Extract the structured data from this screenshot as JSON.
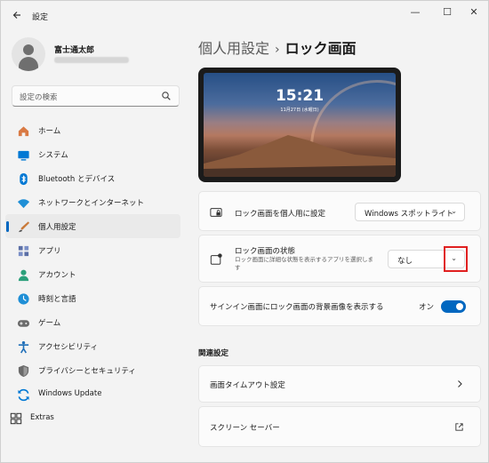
{
  "window": {
    "title": "設定",
    "back_icon": "back-arrow-icon",
    "controls": {
      "minimize": "—",
      "maximize": "☐",
      "close": "✕"
    }
  },
  "profile": {
    "name": "富士通太郎",
    "email": ""
  },
  "search": {
    "placeholder": "設定の検索",
    "icon": "search-icon"
  },
  "sidebar": {
    "items": [
      {
        "label": "ホーム",
        "icon": "home-icon",
        "color": "#d97a44"
      },
      {
        "label": "システム",
        "icon": "system-icon",
        "color": "#0078d4"
      },
      {
        "label": "Bluetooth とデバイス",
        "icon": "bluetooth-icon",
        "color": "#0078d4"
      },
      {
        "label": "ネットワークとインターネット",
        "icon": "network-icon",
        "color": "#1f8fd6"
      },
      {
        "label": "個人用設定",
        "icon": "personalization-icon",
        "color": "#c97a3a",
        "active": true
      },
      {
        "label": "アプリ",
        "icon": "apps-icon",
        "color": "#5b6fa6"
      },
      {
        "label": "アカウント",
        "icon": "account-icon",
        "color": "#2ba07a"
      },
      {
        "label": "時刻と言語",
        "icon": "time-language-icon",
        "color": "#1f8fd6"
      },
      {
        "label": "ゲーム",
        "icon": "gaming-icon",
        "color": "#6b6b6b"
      },
      {
        "label": "アクセシビリティ",
        "icon": "accessibility-icon",
        "color": "#1f6fb8"
      },
      {
        "label": "プライバシーとセキュリティ",
        "icon": "shield-icon",
        "color": "#6b6b6b"
      },
      {
        "label": "Windows Update",
        "icon": "windows-update-icon",
        "color": "#0078d4"
      },
      {
        "label": "Extras",
        "icon": "extras-icon",
        "color": "#333333"
      }
    ]
  },
  "main": {
    "breadcrumb": {
      "parent": "個人用設定",
      "separator": "›",
      "current": "ロック画面"
    },
    "preview": {
      "time": "15:21",
      "date": "11月27日 (水曜日)"
    },
    "settings": {
      "personalize": {
        "label": "ロック画面を個人用に設定",
        "value": "Windows スポットライト",
        "icon": "lock-screen-icon"
      },
      "status": {
        "label": "ロック画面の状態",
        "description": "ロック画面に詳細な状態を表示するアプリを選択します",
        "value": "なし",
        "icon": "status-icon"
      },
      "signin": {
        "label": "サインイン画面にロック画面の背景画像を表示する",
        "toggle_label": "オン"
      }
    },
    "related": {
      "title": "関連設定",
      "items": [
        {
          "label": "画面タイムアウト設定",
          "icon": "chevron-right-icon"
        },
        {
          "label": "スクリーン セーバー",
          "icon": "external-link-icon"
        }
      ]
    }
  },
  "colors": {
    "accent": "#0067c0",
    "highlight": "#e02020"
  }
}
